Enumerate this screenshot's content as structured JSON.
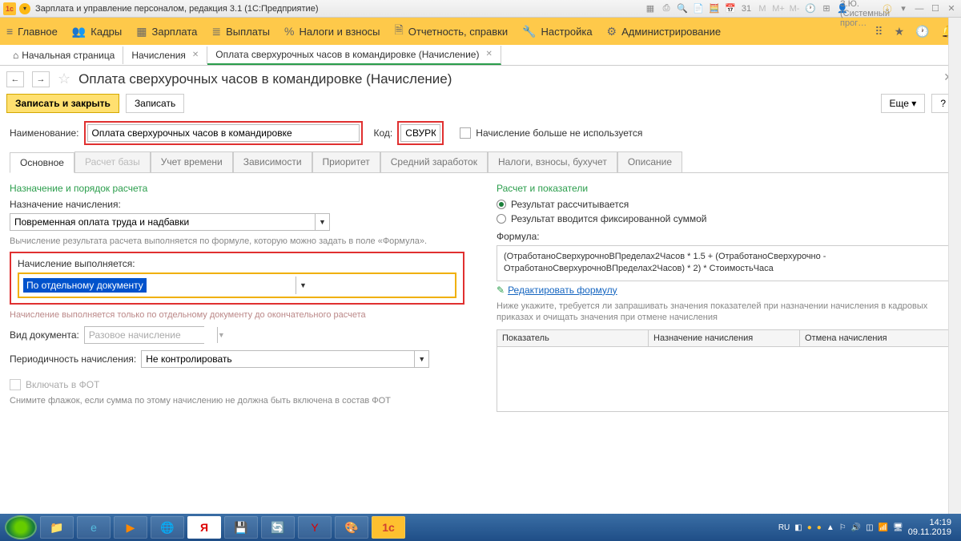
{
  "titlebar": {
    "title": "Зарплата и управление персоналом, редакция 3.1  (1С:Предприятие)",
    "user": "Савинская З.Ю. (Системный прог…"
  },
  "mainmenu": {
    "items": [
      "Главное",
      "Кадры",
      "Зарплата",
      "Выплаты",
      "Налоги и взносы",
      "Отчетность, справки",
      "Настройка",
      "Администрирование"
    ]
  },
  "breadcrumb": {
    "home": "Начальная страница",
    "t1": "Начисления",
    "t2": "Оплата сверхурочных часов в командировке (Начисление)"
  },
  "page": {
    "title": "Оплата сверхурочных часов в командировке (Начисление)"
  },
  "buttons": {
    "save_close": "Записать и закрыть",
    "save": "Записать",
    "more": "Еще",
    "help": "?"
  },
  "fields": {
    "name_label": "Наименование:",
    "name_value": "Оплата сверхурочных часов в командировке",
    "code_label": "Код:",
    "code_value": "СВУРК",
    "not_used_label": "Начисление больше не используется"
  },
  "tabs": [
    "Основное",
    "Расчет базы",
    "Учет времени",
    "Зависимости",
    "Приоритет",
    "Средний заработок",
    "Налоги, взносы, бухучет",
    "Описание"
  ],
  "left": {
    "h1": "Назначение и порядок расчета",
    "assign_label": "Назначение начисления:",
    "assign_value": "Повременная оплата труда и надбавки",
    "hint1": "Вычисление результата расчета выполняется по формуле, которую можно задать в поле «Формула».",
    "exec_label": "Начисление выполняется:",
    "exec_value": "По отдельному документу",
    "hint2": "Начисление выполняется только по отдельному документу до окончательного расчета",
    "doc_label": "Вид документа:",
    "doc_value": "Разовое начисление",
    "period_label": "Периодичность начисления:",
    "period_value": "Не контролировать",
    "fot_label": "Включать в ФОТ",
    "fot_hint": "Снимите флажок, если сумма по этому начислению не должна быть включена в состав ФОТ"
  },
  "right": {
    "h1": "Расчет и показатели",
    "r1": "Результат рассчитывается",
    "r2": "Результат вводится фиксированной суммой",
    "formula_label": "Формула:",
    "formula": "(ОтработаноСверхурочноВПределах2Часов * 1.5 + (ОтработаноСверхурочно - ОтработаноСверхурочноВПределах2Часов) * 2) * СтоимостьЧаса",
    "edit_link": "Редактировать формулу",
    "hint": "Ниже укажите, требуется ли запрашивать значения показателей при назначении начисления в кадровых приказах и очищать значения при отмене начисления",
    "grid_cols": [
      "Показатель",
      "Назначение начисления",
      "Отмена начисления"
    ]
  },
  "taskbar": {
    "lang": "RU",
    "time": "14:19",
    "date": "09.11.2019"
  }
}
